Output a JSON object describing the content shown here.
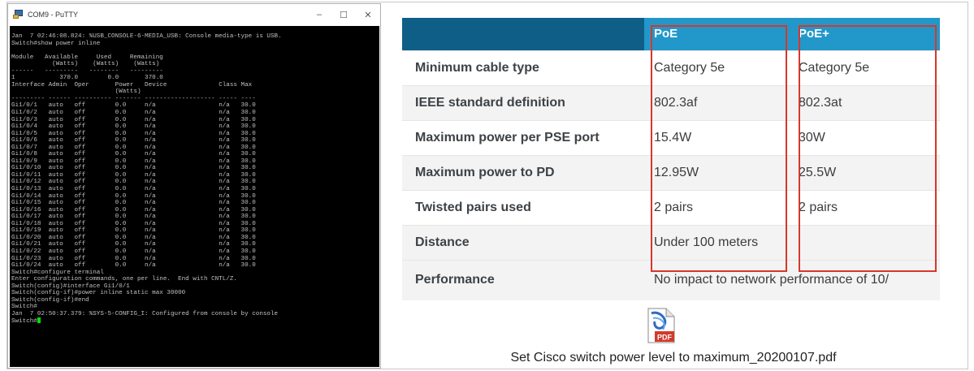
{
  "putty": {
    "title": "COM9 - PuTTY",
    "minimize": "–",
    "maximize": "☐",
    "close": "✕",
    "lines": [
      "Jan  7 02:46:08.824: %USB_CONSOLE-6-MEDIA_USB: Console media-type is USB.",
      "Switch#show power inline",
      "",
      "Module   Available     Used     Remaining",
      "           (Watts)    (Watts)    (Watts)",
      "------   ---------   --------   ---------",
      "1            370.0        0.0       370.0",
      "Interface Admin  Oper       Power   Device              Class Max",
      "                            (Watts)",
      "--------- ------ ---------- ------- ------------------- ----- ----",
      "Gi1/0/1   auto   off        0.0     n/a                 n/a   30.0",
      "Gi1/0/2   auto   off        0.0     n/a                 n/a   30.0",
      "Gi1/0/3   auto   off        0.0     n/a                 n/a   30.0",
      "Gi1/0/4   auto   off        0.0     n/a                 n/a   30.0",
      "Gi1/0/5   auto   off        0.0     n/a                 n/a   30.0",
      "Gi1/0/6   auto   off        0.0     n/a                 n/a   30.0",
      "Gi1/0/7   auto   off        0.0     n/a                 n/a   30.0",
      "Gi1/0/8   auto   off        0.0     n/a                 n/a   30.0",
      "Gi1/0/9   auto   off        0.0     n/a                 n/a   30.0",
      "Gi1/0/10  auto   off        0.0     n/a                 n/a   30.0",
      "Gi1/0/11  auto   off        0.0     n/a                 n/a   30.0",
      "Gi1/0/12  auto   off        0.0     n/a                 n/a   30.0",
      "Gi1/0/13  auto   off        0.0     n/a                 n/a   30.0",
      "Gi1/0/14  auto   off        0.0     n/a                 n/a   30.0",
      "Gi1/0/15  auto   off        0.0     n/a                 n/a   30.0",
      "Gi1/0/16  auto   off        0.0     n/a                 n/a   30.0",
      "Gi1/0/17  auto   off        0.0     n/a                 n/a   30.0",
      "Gi1/0/18  auto   off        0.0     n/a                 n/a   30.0",
      "Gi1/0/19  auto   off        0.0     n/a                 n/a   30.0",
      "Gi1/0/20  auto   off        0.0     n/a                 n/a   30.0",
      "Gi1/0/21  auto   off        0.0     n/a                 n/a   30.0",
      "Gi1/0/22  auto   off        0.0     n/a                 n/a   30.0",
      "Gi1/0/23  auto   off        0.0     n/a                 n/a   30.0",
      "Gi1/0/24  auto   off        0.0     n/a                 n/a   30.0",
      "Switch#configure terminal",
      "Enter configuration commands, one per line.  End with CNTL/Z.",
      "Switch(config)#interface Gi1/0/1",
      "Switch(config-if)#power inline static max 30000",
      "Switch(config-if)#end",
      "Switch#",
      "Jan  7 02:50:37.379: %SYS-5-CONFIG_I: Configured from console by console",
      "Switch#"
    ]
  },
  "table": {
    "headers": {
      "corner": "",
      "poe": "PoE",
      "poe_plus": "PoE+"
    },
    "rows": [
      {
        "label": "Minimum cable type",
        "poe": "Category 5e",
        "poe_plus": "Category 5e"
      },
      {
        "label": "IEEE standard definition",
        "poe": "802.3af",
        "poe_plus": "802.3at"
      },
      {
        "label": "Maximum power per PSE port",
        "poe": "15.4W",
        "poe_plus": "30W"
      },
      {
        "label": "Maximum power to PD",
        "poe": "12.95W",
        "poe_plus": "25.5W"
      },
      {
        "label": "Twisted pairs used",
        "poe": "2 pairs",
        "poe_plus": "2 pairs"
      },
      {
        "label": "Distance",
        "poe": "Under 100 meters",
        "poe_plus": ""
      }
    ],
    "performance": {
      "label": "Performance",
      "value": "No impact to network performance of 10/"
    }
  },
  "attachment": {
    "icon": "pdf-file-icon",
    "badge": "PDF",
    "filename": "Set Cisco switch power level to maximum_20200107.pdf"
  },
  "colors": {
    "header_dark": "#0f5e87",
    "header_accent": "#2297c9",
    "highlight": "#d9362b",
    "terminal_bg": "#000000",
    "terminal_text": "#c0c0c0",
    "cursor": "#00e000"
  }
}
